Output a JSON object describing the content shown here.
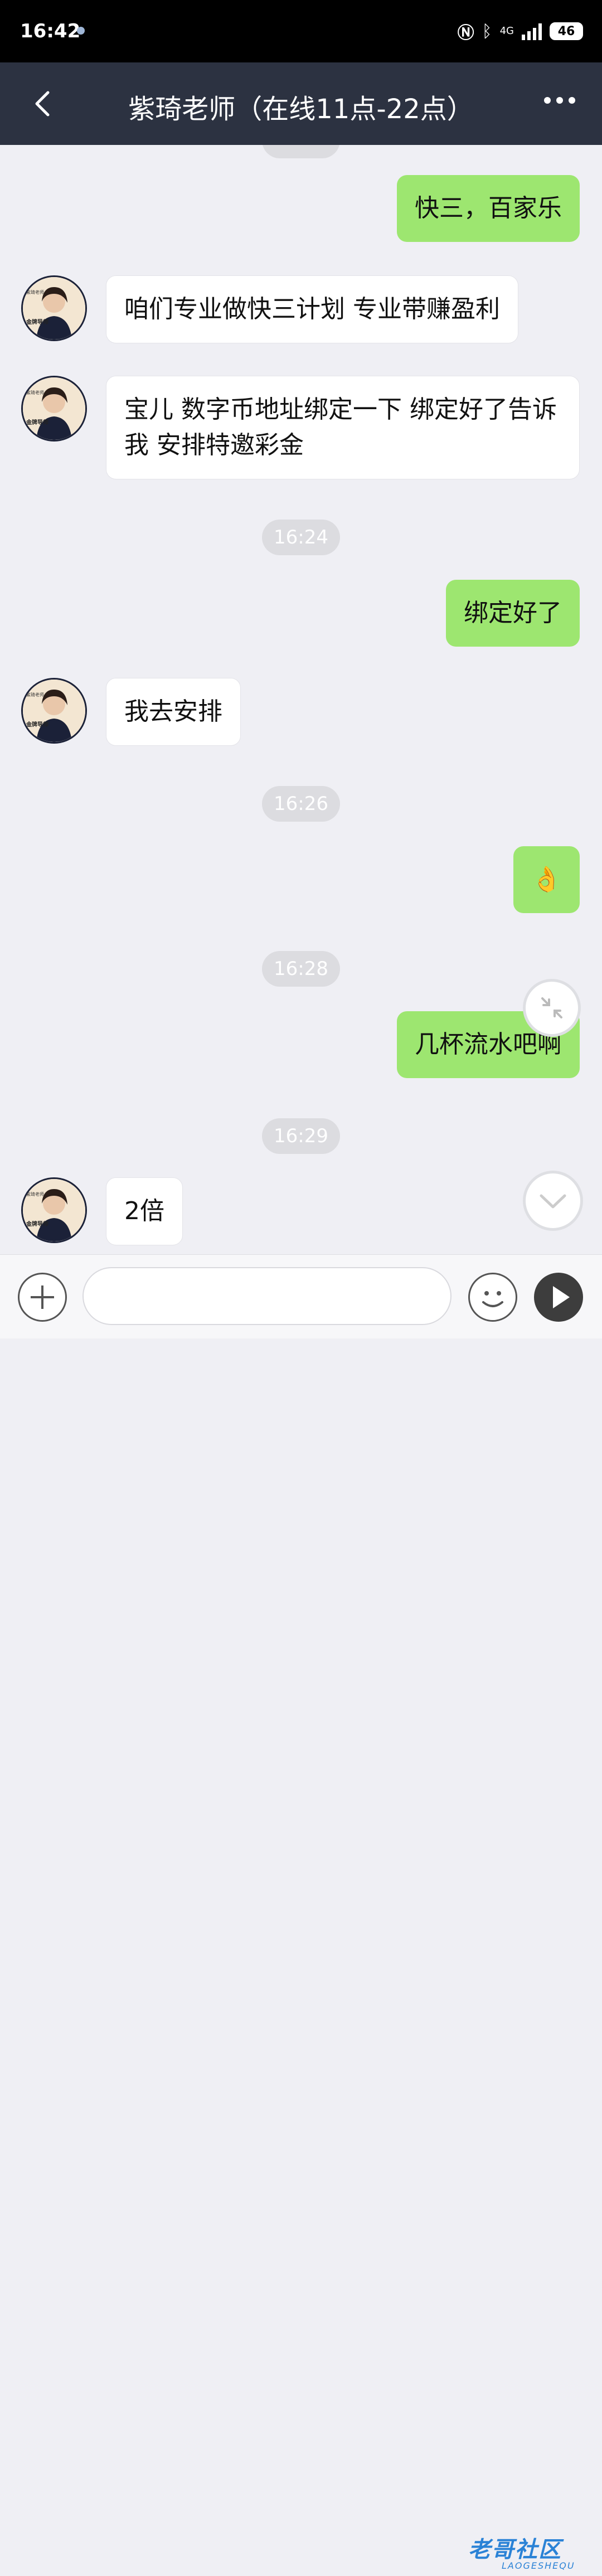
{
  "status_bar": {
    "time": "16:42",
    "network": "4G",
    "battery": "46",
    "icons": [
      "nfc-icon",
      "bluetooth-icon",
      "signal-icon",
      "battery-icon"
    ]
  },
  "header": {
    "title": "紫琦老师（在线11点-22点）",
    "back_icon": "chevron-left-icon",
    "more_icon": "ellipsis-icon",
    "background": "#2c3241"
  },
  "avatar": {
    "name_plate": "金牌导师",
    "top_text": "紫琦老师",
    "sub_text": "快三计划 专业指导 带你赚"
  },
  "messages": [
    {
      "type": "sent",
      "text": "快三，百家乐"
    },
    {
      "type": "received",
      "text": "咱们专业做快三计划 专业带赚盈利"
    },
    {
      "type": "received",
      "text": "宝儿 数字币地址绑定一下 绑定好了告诉我 安排特邀彩金"
    },
    {
      "type": "time",
      "text": "16:24"
    },
    {
      "type": "sent",
      "text": "绑定好了"
    },
    {
      "type": "received",
      "text": "我去安排"
    },
    {
      "type": "time",
      "text": "16:26"
    },
    {
      "type": "sent",
      "text": "👌"
    },
    {
      "type": "time",
      "text": "16:28"
    },
    {
      "type": "sent",
      "text": "几杯流水吧啊"
    },
    {
      "type": "time",
      "text": "16:29"
    },
    {
      "type": "received",
      "text": "2倍"
    }
  ],
  "input_bar": {
    "placeholder": "",
    "plus_icon": "plus-icon",
    "emoji_icon": "emoji-icon",
    "send_icon": "play-icon"
  },
  "watermark": {
    "text": "老哥社区",
    "sub": "LAOGESHEQU"
  },
  "colors": {
    "sent_bubble": "#9de670",
    "received_bubble": "#ffffff",
    "chat_background": "#efeff4"
  }
}
